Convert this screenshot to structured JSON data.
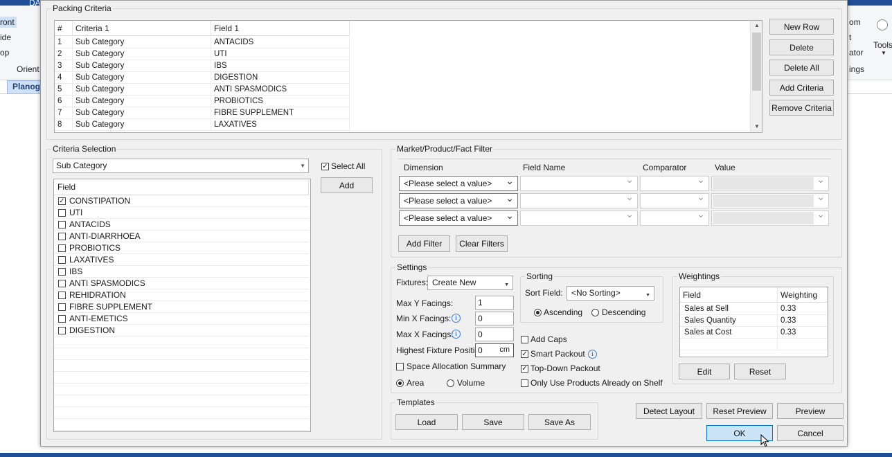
{
  "background_app": {
    "tab_partial": "DA",
    "ribbon_left": [
      "ront",
      "ide",
      "op"
    ],
    "orient_label": "Orient",
    "planogram_tab": "Planogr",
    "ribbon_right": [
      "om",
      "t",
      "ator",
      "ings"
    ],
    "tools_label": "Tools"
  },
  "packing_criteria": {
    "title": "Packing Criteria",
    "columns": [
      "#",
      "Criteria 1",
      "Field 1"
    ],
    "rows": [
      {
        "num": "1",
        "criteria": "Sub Category",
        "field": "ANTACIDS"
      },
      {
        "num": "2",
        "criteria": "Sub Category",
        "field": "UTI"
      },
      {
        "num": "3",
        "criteria": "Sub Category",
        "field": "IBS"
      },
      {
        "num": "4",
        "criteria": "Sub Category",
        "field": "DIGESTION"
      },
      {
        "num": "5",
        "criteria": "Sub Category",
        "field": "ANTI SPASMODICS"
      },
      {
        "num": "6",
        "criteria": "Sub Category",
        "field": "PROBIOTICS"
      },
      {
        "num": "7",
        "criteria": "Sub Category",
        "field": "FIBRE SUPPLEMENT"
      },
      {
        "num": "8",
        "criteria": "Sub Category",
        "field": "LAXATIVES"
      }
    ],
    "buttons": {
      "new_row": "New Row",
      "delete": "Delete",
      "delete_all": "Delete All",
      "add_criteria": "Add Criteria",
      "remove_criteria": "Remove Criteria"
    }
  },
  "criteria_selection": {
    "title": "Criteria Selection",
    "combo_value": "Sub Category",
    "select_all_label": "Select All",
    "add_label": "Add",
    "field_header": "Field",
    "items": [
      {
        "label": "CONSTIPATION",
        "checked": true
      },
      {
        "label": "UTI",
        "checked": false
      },
      {
        "label": "ANTACIDS",
        "checked": false
      },
      {
        "label": "ANTI-DIARRHOEA",
        "checked": false
      },
      {
        "label": "PROBIOTICS",
        "checked": false
      },
      {
        "label": "LAXATIVES",
        "checked": false
      },
      {
        "label": "IBS",
        "checked": false
      },
      {
        "label": "ANTI SPASMODICS",
        "checked": false
      },
      {
        "label": "REHIDRATION",
        "checked": false
      },
      {
        "label": "FIBRE SUPPLEMENT",
        "checked": false
      },
      {
        "label": "ANTI-EMETICS",
        "checked": false
      },
      {
        "label": "DIGESTION",
        "checked": false
      }
    ]
  },
  "filter": {
    "title": "Market/Product/Fact Filter",
    "columns": [
      "Dimension",
      "Field Name",
      "Comparator",
      "Value"
    ],
    "rows": [
      {
        "dimension": "<Please select a value>"
      },
      {
        "dimension": "<Please select a value>"
      },
      {
        "dimension": "<Please select a value>"
      }
    ],
    "add_filter": "Add Filter",
    "clear_filters": "Clear Filters"
  },
  "settings": {
    "title": "Settings",
    "fixtures_label": "Fixtures:",
    "fixtures_value": "Create New",
    "max_y_label": "Max Y Facings:",
    "max_y_value": "1",
    "min_x_label": "Min X Facings:",
    "min_x_value": "0",
    "max_x_label": "Max X Facings:",
    "max_x_value": "0",
    "highest_label": "Highest Fixture Position:",
    "highest_value": "0",
    "highest_unit": "cm",
    "space_alloc_label": "Space Allocation Summary",
    "area_label": "Area",
    "volume_label": "Volume",
    "sorting": {
      "title": "Sorting",
      "sort_field_label": "Sort Field:",
      "sort_field_value": "<No Sorting>",
      "ascending": "Ascending",
      "descending": "Descending"
    },
    "add_caps": "Add Caps",
    "smart_packout": "Smart Packout",
    "top_down": "Top-Down Packout",
    "only_use": "Only Use Products Already on Shelf",
    "weightings": {
      "title": "Weightings",
      "col_field": "Field",
      "col_weighting": "Weighting",
      "rows": [
        {
          "field": "Sales at Sell",
          "weight": "0.33"
        },
        {
          "field": "Sales Quantity",
          "weight": "0.33"
        },
        {
          "field": "Sales at Cost",
          "weight": "0.33"
        }
      ],
      "edit": "Edit",
      "reset": "Reset"
    }
  },
  "templates": {
    "title": "Templates",
    "load": "Load",
    "save": "Save",
    "save_as": "Save As"
  },
  "footer": {
    "detect_layout": "Detect Layout",
    "reset_preview": "Reset Preview",
    "preview": "Preview",
    "ok": "OK",
    "cancel": "Cancel"
  }
}
